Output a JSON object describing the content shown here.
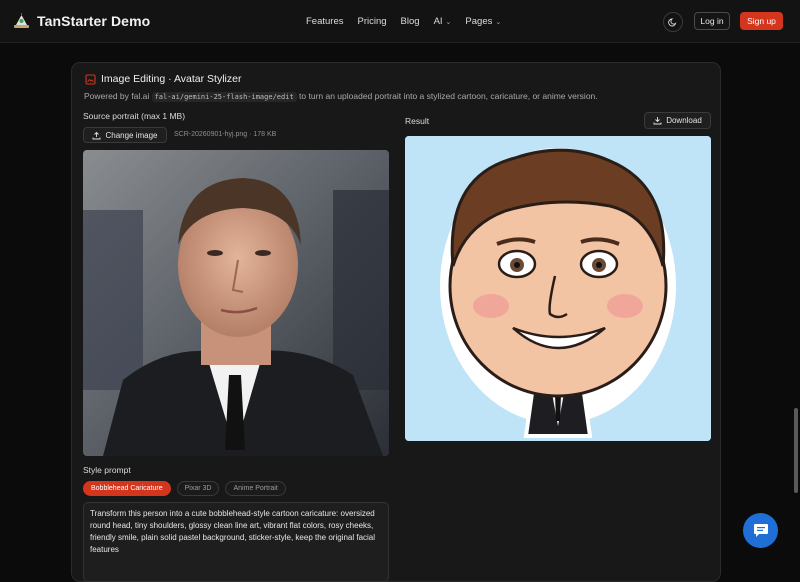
{
  "header": {
    "brand": "TanStarter Demo",
    "nav": [
      {
        "label": "Features",
        "has_dropdown": false
      },
      {
        "label": "Pricing",
        "has_dropdown": false
      },
      {
        "label": "Blog",
        "has_dropdown": false
      },
      {
        "label": "AI",
        "has_dropdown": true
      },
      {
        "label": "Pages",
        "has_dropdown": true
      }
    ],
    "theme_icon": "moon-icon",
    "login_label": "Log in",
    "signup_label": "Sign up"
  },
  "card": {
    "icon": "image-edit-icon",
    "title": "Image Editing · Avatar Stylizer",
    "desc_before": "Powered by fal.ai",
    "desc_code": "fal-ai/gemini-25-flash-image/edit",
    "desc_after": "to turn an uploaded portrait into a stylized cartoon, caricature, or anime version.",
    "source_label": "Source portrait (max 1 MB)",
    "change_button": "Change image",
    "file_info": "SCR-20260901-hyj.png · 178 KB",
    "result_label": "Result",
    "download_button": "Download",
    "style_label": "Style prompt",
    "styles": [
      {
        "label": "Bobblehead Caricature",
        "active": true
      },
      {
        "label": "Pixar 3D",
        "active": false
      },
      {
        "label": "Anime Portrait",
        "active": false
      }
    ],
    "prompt_text": "Transform this person into a cute bobblehead-style cartoon caricature: oversized round head, tiny shoulders, glossy clean line art, vibrant flat colors, rosy cheeks, friendly smile, plain solid pastel background, sticker-style, keep the original facial features"
  },
  "colors": {
    "accent": "#d4361d",
    "background": "#0b0b0b",
    "card": "#181818",
    "chat": "#1f6fd6",
    "result_bg": "#bfe3f7"
  }
}
